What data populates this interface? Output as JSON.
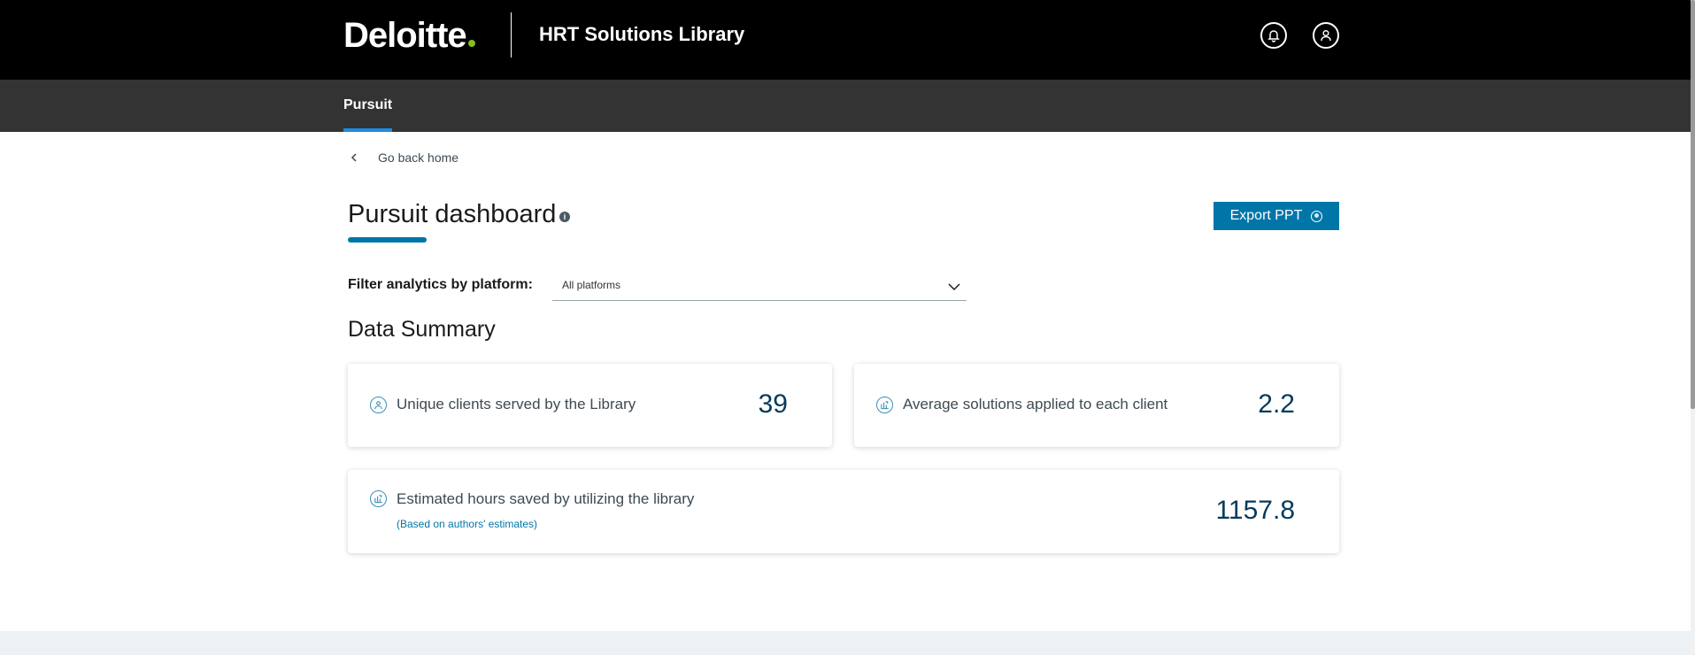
{
  "header": {
    "logo_text": "Deloitte",
    "app_title": "HRT Solutions Library",
    "icons": [
      "bell-icon",
      "user-icon"
    ],
    "brand_colors": {
      "black": "#000000",
      "logo_dot": "#86bc25"
    }
  },
  "subnav": {
    "tabs": [
      {
        "label": "Pursuit",
        "active": true
      }
    ],
    "accent": "#1e8be0"
  },
  "back_link": {
    "label": "Go back home"
  },
  "page": {
    "title": "Pursuit dashboard",
    "info_icon": "info-icon",
    "export_button": {
      "label": "Export PPT",
      "icon": "ppt-icon"
    }
  },
  "filter": {
    "label": "Filter analytics by platform:",
    "selected": "All platforms"
  },
  "summary": {
    "title": "Data Summary",
    "cards": [
      {
        "icon": "user-circle-icon",
        "label": "Unique clients served by the Library",
        "value": "39"
      },
      {
        "icon": "chart-icon",
        "label": "Average solutions applied to each client",
        "value": "2.2"
      },
      {
        "icon": "chart-icon",
        "label": "Estimated hours saved by utilizing the library",
        "sublabel": "(Based on authors' estimates)",
        "value": "1157.8"
      }
    ]
  },
  "colors": {
    "primary": "#0076a8",
    "value_text": "#063a5c"
  }
}
